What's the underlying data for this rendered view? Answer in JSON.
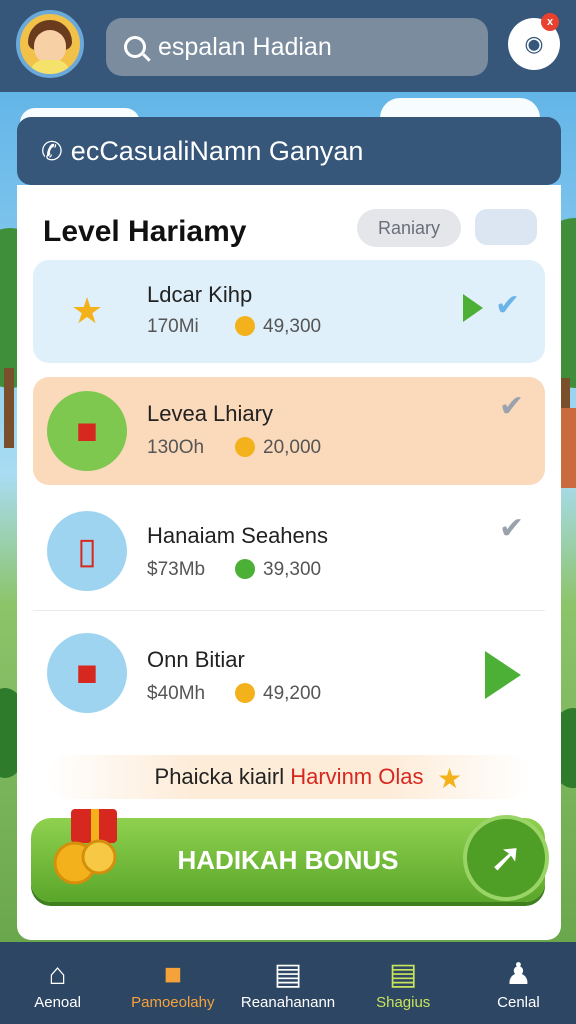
{
  "search": {
    "text": "espalan Hadian"
  },
  "notification_badge": "x",
  "banner": {
    "title": "ecCasualiNamn Ganyan"
  },
  "panel": {
    "title": "Level Hariamy",
    "pill_label": "Raniary"
  },
  "items": [
    {
      "title": "Ldcar Kihp",
      "sub1": "170Mi",
      "sub2": "49,300",
      "icon": "badge-icon",
      "bg": "#dff0fb"
    },
    {
      "title": "Levea Lhiary",
      "sub1": "130Oh",
      "sub2": "20,000",
      "icon": "gift-boxes-icon",
      "bg": "#fbd9bb"
    },
    {
      "title": "Hanaiam Seahens",
      "sub1": "$73Mb",
      "sub2": "39,300",
      "icon": "phone-icon",
      "bg": "#ffffff"
    },
    {
      "title": "Onn Bitiar",
      "sub1": "$40Mh",
      "sub2": "49,200",
      "icon": "gift-icon",
      "bg": "#ffffff"
    }
  ],
  "promo": {
    "text_main": "Phaicka kiairl ",
    "text_red": "Harvinm Olas"
  },
  "bonus": {
    "label": "HADIKAH BONUS"
  },
  "nav": [
    {
      "label": "Aenoal",
      "icon": "home-icon"
    },
    {
      "label": "Pamoeolahy",
      "icon": "ranking-icon"
    },
    {
      "label": "Reanahanann",
      "icon": "list-icon"
    },
    {
      "label": "Shagius",
      "icon": "shop-icon"
    },
    {
      "label": "Cenlal",
      "icon": "profile-icon"
    }
  ],
  "colors": {
    "primary": "#36567a",
    "accent_green": "#5aa62a",
    "coin": "#f3b21c",
    "nav_orange": "#f6a23a",
    "nav_green": "#c9e35a"
  }
}
